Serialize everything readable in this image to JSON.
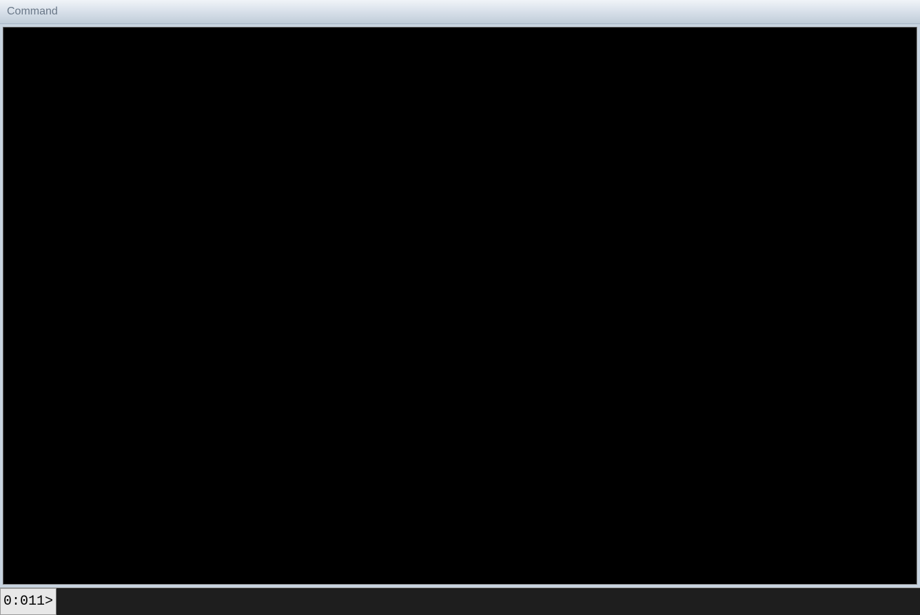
{
  "window": {
    "title": "Command"
  },
  "debugger": {
    "prompt": "0:011>",
    "input_value": ""
  }
}
